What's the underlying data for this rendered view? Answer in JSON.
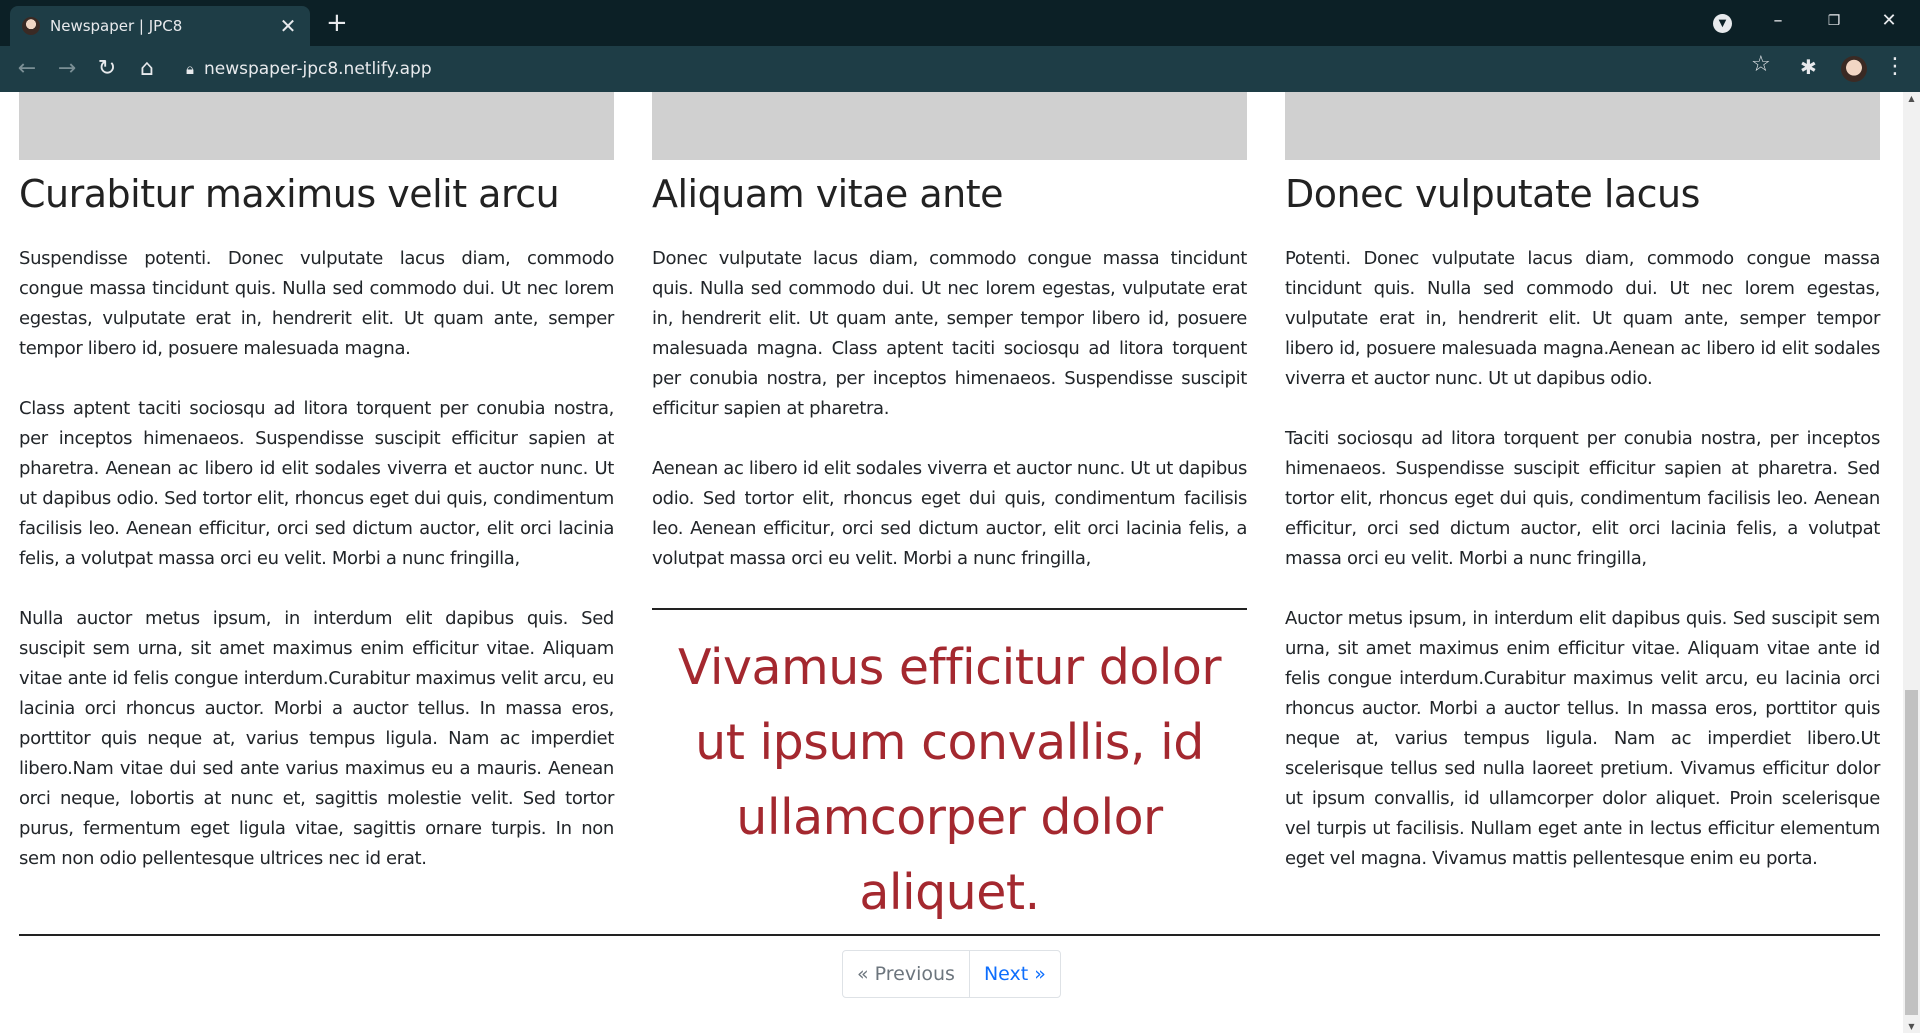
{
  "browser": {
    "tab_title": "Newspaper | JPC8",
    "tab_close": "✕",
    "new_tab": "+",
    "url": "newspaper-jpc8.netlify.app",
    "window_controls": {
      "minimize": "–",
      "maximize": "❐",
      "close": "✕"
    },
    "icons": [
      "back-icon",
      "forward-icon",
      "reload-icon",
      "home-icon",
      "lock-icon",
      "star-icon",
      "extensions-icon",
      "kebab-menu-icon"
    ]
  },
  "articles": [
    {
      "headline": "Curabitur maximus velit arcu",
      "paragraphs": [
        "Suspendisse potenti. Donec vulputate lacus diam, commodo congue massa tincidunt quis. Nulla sed commodo dui. Ut nec lorem egestas, vulputate erat in, hendrerit elit. Ut quam ante, semper tempor libero id, posuere malesuada magna.",
        "Class aptent taciti sociosqu ad litora torquent per conubia nostra, per inceptos himenaeos. Suspendisse suscipit efficitur sapien at pharetra. Aenean ac libero id elit sodales viverra et auctor nunc. Ut ut dapibus odio. Sed tortor elit, rhoncus eget dui quis, condimentum facilisis leo. Aenean efficitur, orci sed dictum auctor, elit orci lacinia felis, a volutpat massa orci eu velit. Morbi a nunc fringilla,",
        "Nulla auctor metus ipsum, in interdum elit dapibus quis. Sed suscipit sem urna, sit amet maximus enim efficitur vitae. Aliquam vitae ante id felis congue interdum.Curabitur maximus velit arcu, eu lacinia orci rhoncus auctor. Morbi a auctor tellus. In massa eros, porttitor quis neque at, varius tempus ligula. Nam ac imperdiet libero.Nam vitae dui sed ante varius maximus eu a mauris. Aenean orci neque, lobortis at nunc et, sagittis molestie velit. Sed tortor purus, fermentum eget ligula vitae, sagittis ornare turpis. In non sem non odio pellentesque ultrices nec id erat."
      ]
    },
    {
      "headline": "Aliquam vitae ante",
      "paragraphs": [
        "Donec vulputate lacus diam, commodo congue massa tincidunt quis. Nulla sed commodo dui. Ut nec lorem egestas, vulputate erat in, hendrerit elit. Ut quam ante, semper tempor libero id, posuere malesuada magna. Class aptent taciti sociosqu ad litora torquent per conubia nostra, per inceptos himenaeos. Suspendisse suscipit efficitur sapien at pharetra.",
        "Aenean ac libero id elit sodales viverra et auctor nunc. Ut ut dapibus odio. Sed tortor elit, rhoncus eget dui quis, condimentum facilisis leo. Aenean efficitur, orci sed dictum auctor, elit orci lacinia felis, a volutpat massa orci eu velit. Morbi a nunc fringilla,"
      ],
      "pull_quote": "Vivamus efficitur dolor ut ipsum convallis, id ullamcorper dolor aliquet."
    },
    {
      "headline": "Donec vulputate lacus",
      "paragraphs": [
        "Potenti. Donec vulputate lacus diam, commodo congue massa tincidunt quis. Nulla sed commodo dui. Ut nec lorem egestas, vulputate erat in, hendrerit elit. Ut quam ante, semper tempor libero id, posuere malesuada magna.Aenean ac libero id elit sodales viverra et auctor nunc. Ut ut dapibus odio.",
        "Taciti sociosqu ad litora torquent per conubia nostra, per inceptos himenaeos. Suspendisse suscipit efficitur sapien at pharetra. Sed tortor elit, rhoncus eget dui quis, condimentum facilisis leo. Aenean efficitur, orci sed dictum auctor, elit orci lacinia felis, a volutpat massa orci eu velit. Morbi a nunc fringilla,",
        "Auctor metus ipsum, in interdum elit dapibus quis. Sed suscipit sem urna, sit amet maximus enim efficitur vitae. Aliquam vitae ante id felis congue interdum.Curabitur maximus velit arcu, eu lacinia orci rhoncus auctor. Morbi a auctor tellus. In massa eros, porttitor quis neque at, varius tempus ligula. Nam ac imperdiet libero.Ut scelerisque tellus sed nulla laoreet pretium. Vivamus efficitur dolor ut ipsum convallis, id ullamcorper dolor aliquet. Proin scelerisque vel turpis ut facilisis. Nullam eget ante in lectus efficitur elementum eget vel magna. Vivamus mattis pellentesque enim eu porta."
      ]
    }
  ],
  "pagination": {
    "previous": "« Previous",
    "next": "Next »"
  },
  "colors": {
    "quote": "#a4282f",
    "link": "#0d6efd",
    "chrome_dark": "#0c2026",
    "chrome_toolbar": "#1e3d46"
  }
}
